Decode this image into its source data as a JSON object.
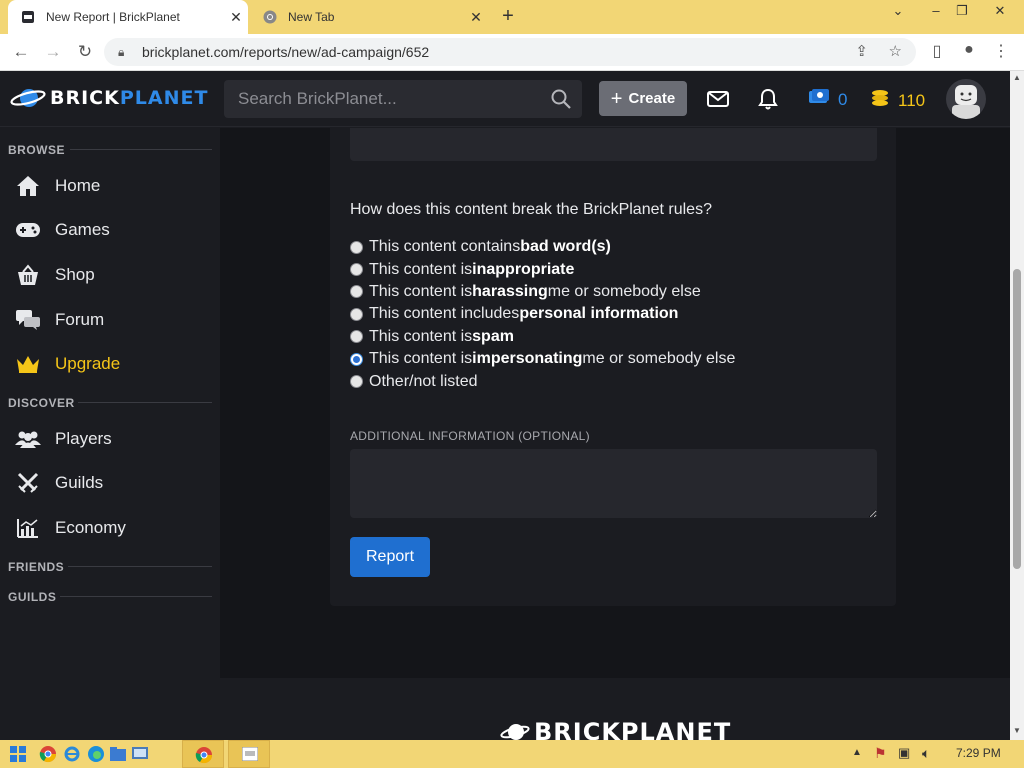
{
  "browser": {
    "tabs": [
      {
        "title": "New Report | BrickPlanet",
        "active": true
      },
      {
        "title": "New Tab",
        "active": false
      }
    ],
    "new_tab_label": "+",
    "url": "brickplanet.com/reports/new/ad-campaign/652"
  },
  "header": {
    "logo_text_a": "BRICK",
    "logo_text_b": "PLANET",
    "search_placeholder": "Search BrickPlanet...",
    "create_label": "Create",
    "credits": "0",
    "bits": "110"
  },
  "sidebar": {
    "browse_label": "BROWSE",
    "browse_items": [
      {
        "label": "Home",
        "icon": "home-icon"
      },
      {
        "label": "Games",
        "icon": "gamepad-icon"
      },
      {
        "label": "Shop",
        "icon": "basket-icon"
      },
      {
        "label": "Forum",
        "icon": "chat-icon"
      },
      {
        "label": "Upgrade",
        "icon": "crown-icon"
      }
    ],
    "discover_label": "DISCOVER",
    "discover_items": [
      {
        "label": "Players",
        "icon": "users-icon"
      },
      {
        "label": "Guilds",
        "icon": "swords-icon"
      },
      {
        "label": "Economy",
        "icon": "chart-icon"
      }
    ],
    "friends_label": "FRIENDS",
    "guilds_label": "GUILDS"
  },
  "form": {
    "question": "How does this content break the BrickPlanet rules?",
    "options": [
      {
        "pre": "This content contains ",
        "bold": "bad word(s)",
        "post": "",
        "checked": false
      },
      {
        "pre": "This content is ",
        "bold": "inappropriate",
        "post": "",
        "checked": false
      },
      {
        "pre": "This content is ",
        "bold": "harassing",
        "post": " me or somebody else",
        "checked": false
      },
      {
        "pre": "This content includes ",
        "bold": "personal information",
        "post": "",
        "checked": false
      },
      {
        "pre": "This content is ",
        "bold": "spam",
        "post": "",
        "checked": false
      },
      {
        "pre": "This content is ",
        "bold": "impersonating",
        "post": " me or somebody else",
        "checked": true
      },
      {
        "pre": "Other/not listed",
        "bold": "",
        "post": "",
        "checked": false
      }
    ],
    "additional_label": "ADDITIONAL INFORMATION (OPTIONAL)",
    "additional_value": "",
    "submit_label": "Report"
  },
  "footer": {
    "logo_text": "BRICKPLANET"
  },
  "taskbar": {
    "time": "7:29 PM"
  },
  "colors": {
    "accent": "#1f6fd0",
    "brand_blue": "#2f8ae8",
    "upgrade_gold": "#f5c518",
    "background": "#141519",
    "panel": "#1b1c21",
    "taskbar": "#f2d675"
  }
}
